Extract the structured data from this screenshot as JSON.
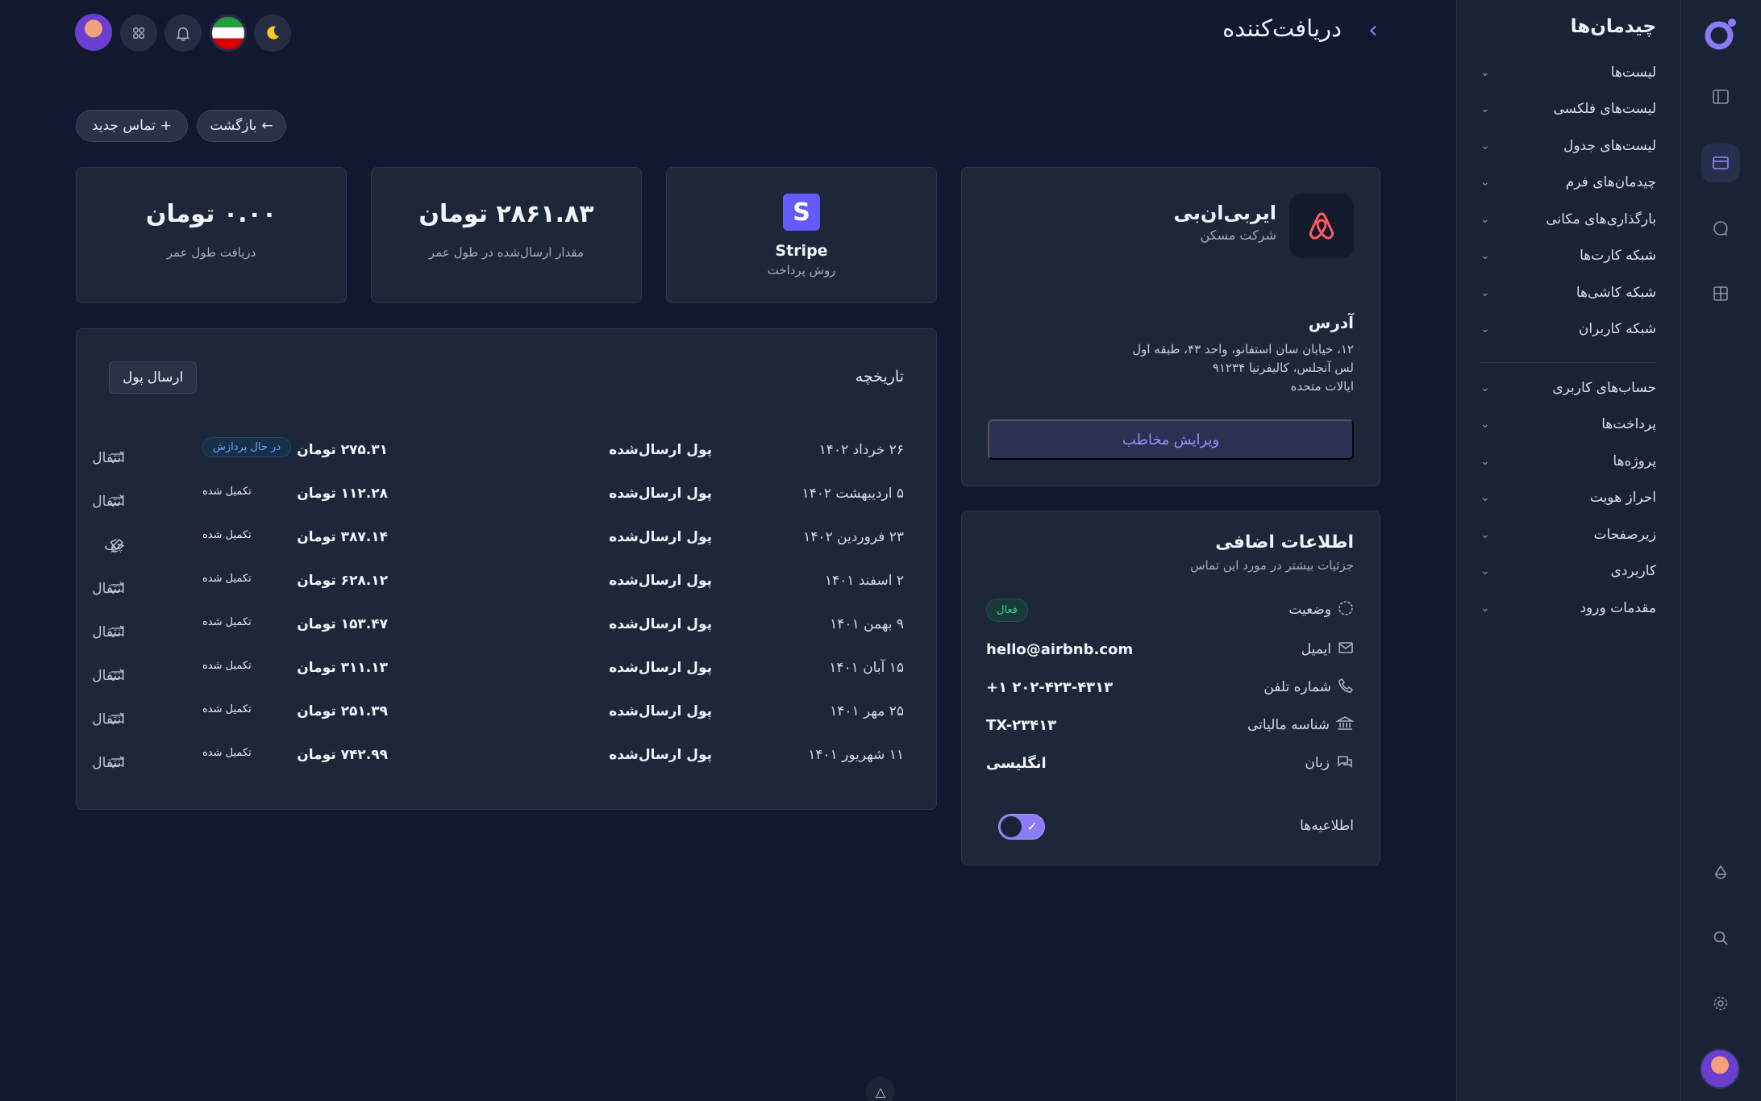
{
  "sidebar": {
    "title": "چیدمان‌ها",
    "items": [
      {
        "label": "لیست‌ها"
      },
      {
        "label": "لیست‌های فلکسی"
      },
      {
        "label": "لیست‌های جدول"
      },
      {
        "label": "چیدمان‌های فرم"
      },
      {
        "label": "بارگذاری‌های مکانی"
      },
      {
        "label": "شبکه کارت‌ها"
      },
      {
        "label": "شبکه کاشی‌ها"
      },
      {
        "label": "شبکه کاربران"
      }
    ],
    "items2": [
      {
        "label": "حساب‌های کاربری"
      },
      {
        "label": "پرداخت‌ها"
      },
      {
        "label": "پروژه‌ها"
      },
      {
        "label": "احراز هویت"
      },
      {
        "label": "زیرصفحات"
      },
      {
        "label": "کاربردی"
      },
      {
        "label": "مقدمات ورود"
      }
    ]
  },
  "header": {
    "title": "دریافت‌کننده",
    "back_label": "بازگشت",
    "new_contact_label": "تماس جدید"
  },
  "profile": {
    "name": "ایربی‌ان‌بی",
    "subtitle": "شرکت مسکن",
    "address_title": "آدرس",
    "address_lines": [
      "۱۲، خیابان سان استفانو، واحد ۴۳، طبقه اول",
      "لس آنجلس، کالیفرنیا ۹۱۲۳۴",
      "ایالات متحده"
    ],
    "edit_label": "ویرایش مخاطب"
  },
  "stats": {
    "payment": {
      "value": "Stripe",
      "label": "روش پرداخت"
    },
    "sent": {
      "value": "۲۸۶۱.۸۳ تومان",
      "label": "مقدار ارسال‌شده در طول عمر"
    },
    "received": {
      "value": "۰.۰۰ تومان",
      "label": "دریافت طول عمر"
    }
  },
  "info": {
    "title": "اطلاعات اضافی",
    "subtitle": "جزئیات بیشتر در مورد این تماس",
    "status_label": "وضعیت",
    "status_value": "فعال",
    "email_label": "ایمیل",
    "email_value": "hello@airbnb.com",
    "phone_label": "شماره تلفن",
    "phone_value": "+۱ ۲۰۲-۴۲۳-۴۳۱۳",
    "tax_label": "شناسه مالیاتی",
    "tax_value": "TX-۲۳۴۱۳",
    "lang_label": "زبان",
    "lang_value": "انگلیسی",
    "notif_label": "اطلاعیه‌ها",
    "notifications_on": true
  },
  "history": {
    "title": "تاریخچه",
    "send_label": "ارسال پول",
    "rows": [
      {
        "date": "۲۶ خرداد ۱۴۰۲",
        "desc": "پول ارسال‌شده",
        "amount": "۲۷۵.۳۱ تومان",
        "status": "در حال پردازش",
        "type": "انتقال",
        "icon": "transfer-icon"
      },
      {
        "date": "۵ اردیبهشت ۱۴۰۲",
        "desc": "پول ارسال‌شده",
        "amount": "۱۱۲.۲۸ تومان",
        "status": "تکمیل شده",
        "type": "انتقال",
        "icon": "transfer-icon"
      },
      {
        "date": "۲۳ فروردین ۱۴۰۲",
        "desc": "پول ارسال‌شده",
        "amount": "۳۸۷.۱۴ تومان",
        "status": "تکمیل شده",
        "type": "چک",
        "icon": "check-pen-icon"
      },
      {
        "date": "۲ اسفند ۱۴۰۱",
        "desc": "پول ارسال‌شده",
        "amount": "۶۲۸.۱۲ تومان",
        "status": "تکمیل شده",
        "type": "انتقال",
        "icon": "transfer-icon"
      },
      {
        "date": "۹ بهمن ۱۴۰۱",
        "desc": "پول ارسال‌شده",
        "amount": "۱۵۳.۴۷ تومان",
        "status": "تکمیل شده",
        "type": "انتقال",
        "icon": "transfer-icon"
      },
      {
        "date": "۱۵ آبان ۱۴۰۱",
        "desc": "پول ارسال‌شده",
        "amount": "۳۱۱.۱۳ تومان",
        "status": "تکمیل شده",
        "type": "انتقال",
        "icon": "transfer-icon"
      },
      {
        "date": "۲۵ مهر ۱۴۰۱",
        "desc": "پول ارسال‌شده",
        "amount": "۲۵۱.۳۹ تومان",
        "status": "تکمیل شده",
        "type": "انتقال",
        "icon": "transfer-icon"
      },
      {
        "date": "۱۱ شهریور ۱۴۰۱",
        "desc": "پول ارسال‌شده",
        "amount": "۷۴۲.۹۹ تومان",
        "status": "تکمیل شده",
        "type": "انتقال",
        "icon": "transfer-icon"
      }
    ]
  },
  "colors": {
    "accent": "#8b7cf6",
    "background": "#111830",
    "card": "#1e263a",
    "success": "#34d399",
    "info": "#60a5fa",
    "brand_airbnb": "#ff5a5f",
    "brand_stripe": "#635bff"
  }
}
